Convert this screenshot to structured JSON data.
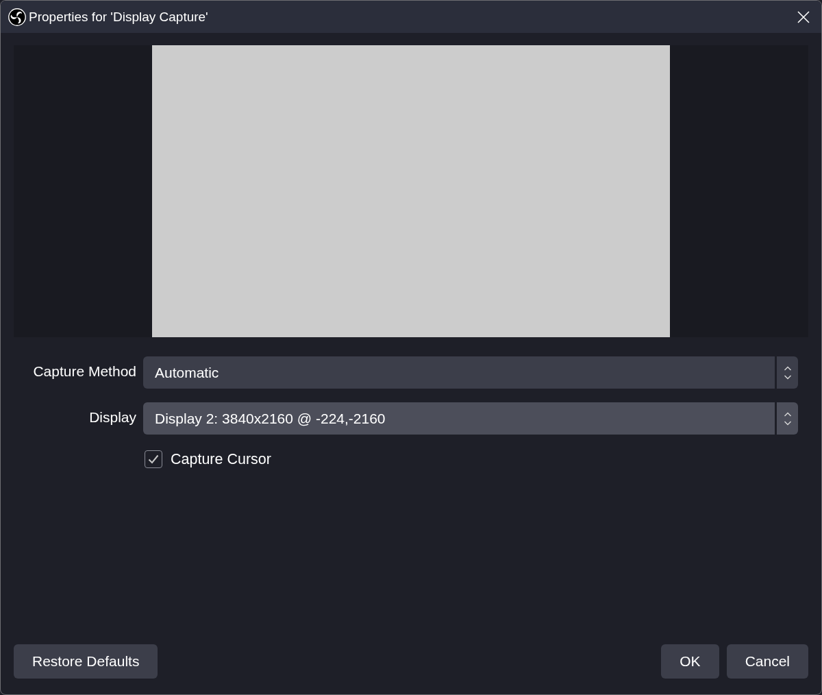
{
  "window": {
    "title": "Properties for 'Display Capture'"
  },
  "properties": [
    {
      "kind": "combo",
      "label": "Capture Method",
      "value": "Automatic",
      "highlighted": false
    },
    {
      "kind": "combo",
      "label": "Display",
      "value": "Display 2: 3840x2160 @ -224,-2160",
      "highlighted": true
    },
    {
      "kind": "checkbox",
      "label": "Capture Cursor",
      "checked": true
    }
  ],
  "footer": {
    "left_buttons": [
      "Restore Defaults"
    ],
    "right_buttons": [
      "OK",
      "Cancel"
    ]
  }
}
